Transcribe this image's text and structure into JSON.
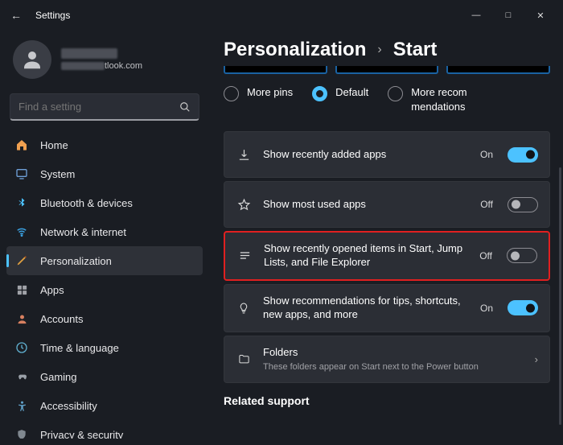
{
  "window": {
    "title": "Settings"
  },
  "profile": {
    "email_suffix": "tlook.com"
  },
  "search": {
    "placeholder": "Find a setting"
  },
  "sidebar": {
    "items": [
      {
        "label": "Home"
      },
      {
        "label": "System"
      },
      {
        "label": "Bluetooth & devices"
      },
      {
        "label": "Network & internet"
      },
      {
        "label": "Personalization"
      },
      {
        "label": "Apps"
      },
      {
        "label": "Accounts"
      },
      {
        "label": "Time & language"
      },
      {
        "label": "Gaming"
      },
      {
        "label": "Accessibility"
      },
      {
        "label": "Privacy & security"
      }
    ]
  },
  "breadcrumb": {
    "parent": "Personalization",
    "current": "Start"
  },
  "layout_radio": {
    "more_pins": "More pins",
    "default": "Default",
    "more_recs": "More recommendations"
  },
  "settings": [
    {
      "label": "Show recently added apps",
      "state": "On",
      "on": true
    },
    {
      "label": "Show most used apps",
      "state": "Off",
      "on": false
    },
    {
      "label": "Show recently opened items in Start, Jump Lists, and File Explorer",
      "state": "Off",
      "on": false
    },
    {
      "label": "Show recommendations for tips, shortcuts, new apps, and more",
      "state": "On",
      "on": true
    }
  ],
  "folders": {
    "label": "Folders",
    "sub": "These folders appear on Start next to the Power button"
  },
  "related": "Related support"
}
